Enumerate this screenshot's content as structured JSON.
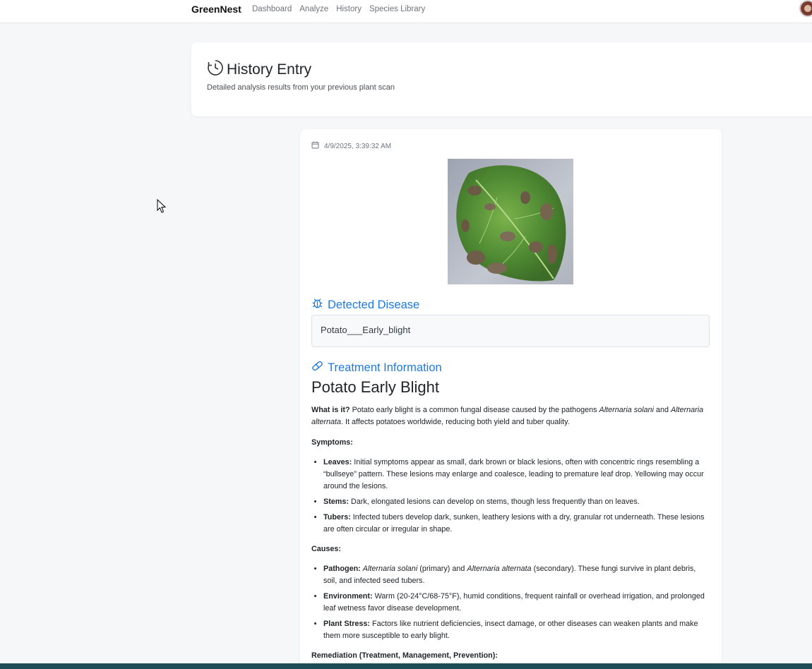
{
  "navbar": {
    "brand": "GreenNest",
    "links": [
      "Dashboard",
      "Analyze",
      "History",
      "Species Library"
    ]
  },
  "header": {
    "title": "History Entry",
    "subtitle": "Detailed analysis results from your previous plant scan",
    "icon": "clock-icon"
  },
  "entry": {
    "timestamp": "4/9/2025, 3:39:32 AM",
    "image_alt": "Uploaded leaf image",
    "detected_heading": "Detected Disease",
    "detected_value": "Potato___Early_blight",
    "treatment_heading": "Treatment Information",
    "treatment_title": "Potato Early Blight",
    "what_label": "What is it?",
    "what_text_1": " Potato early blight is a common fungal disease caused by the pathogens ",
    "what_italic_1": "Alternaria solani",
    "what_text_2": " and ",
    "what_italic_2": "Alternaria alternata",
    "what_text_3": ". It affects potatoes worldwide, reducing both yield and tuber quality.",
    "symptoms_label": "Symptoms:",
    "symptoms": [
      {
        "label": "Leaves:",
        "text": " Initial symptoms appear as small, dark brown or black lesions, often with concentric rings resembling a “bullseye” pattern. These lesions may enlarge and coalesce, leading to premature leaf drop. Yellowing may occur around the lesions."
      },
      {
        "label": "Stems:",
        "text": " Dark, elongated lesions can develop on stems, though less frequently than on leaves."
      },
      {
        "label": "Tubers:",
        "text": " Infected tubers develop dark, sunken, leathery lesions with a dry, granular rot underneath. These lesions are often circular or irregular in shape."
      }
    ],
    "causes_label": "Causes:",
    "causes": {
      "pathogen_label": "Pathogen:",
      "pathogen_italic_1": "Alternaria solani",
      "pathogen_text_1": " (primary) and ",
      "pathogen_italic_2": "Alternaria alternata",
      "pathogen_text_2": " (secondary). These fungi survive in plant debris, soil, and infected seed tubers.",
      "environment_label": "Environment:",
      "environment_text": " Warm (20-24°C/68-75°F), humid conditions, frequent rainfall or overhead irrigation, and prolonged leaf wetness favor disease development.",
      "stress_label": "Plant Stress:",
      "stress_text": " Factors like nutrient deficiencies, insect damage, or other diseases can weaken plants and make them more susceptible to early blight."
    },
    "remediation_label": "Remediation (Treatment, Management, Prevention):"
  },
  "colors": {
    "accent": "#1f7ae0",
    "background": "#f6f7f9",
    "bottom_bar": "#1e4c57"
  }
}
